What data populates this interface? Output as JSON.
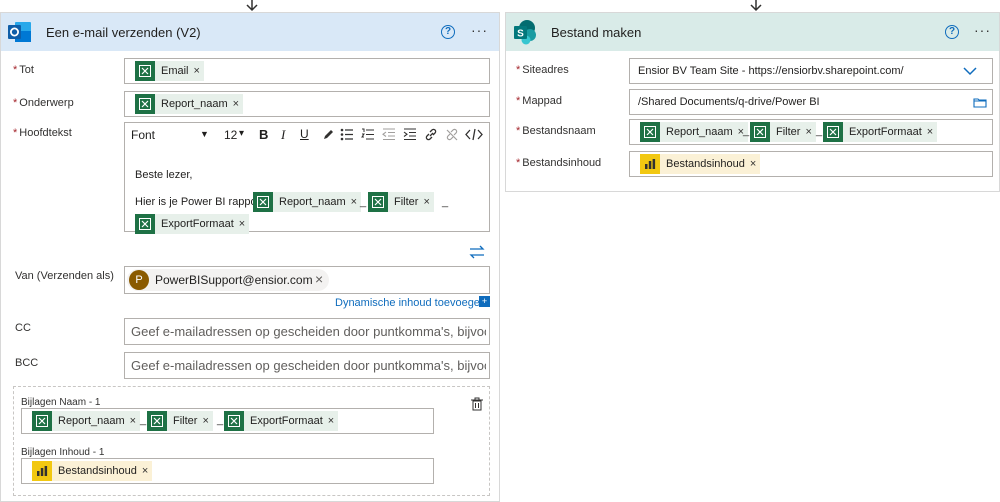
{
  "email_card": {
    "title": "Een e-mail verzenden (V2)",
    "help": "?",
    "more": "···",
    "to_label": "Tot",
    "to_tokens": [
      {
        "label": "Email",
        "close": "×"
      }
    ],
    "subject_label": "Onderwerp",
    "subject_tokens": [
      {
        "label": "Report_naam",
        "close": "×"
      }
    ],
    "body_label": "Hoofdtekst",
    "toolbar": {
      "font": "Font",
      "font_caret": "▼",
      "size": "12",
      "size_caret": "▾",
      "bold": "B",
      "italic": "I",
      "underline": "U"
    },
    "body_greeting": "Beste lezer,",
    "body_line": "Hier is je Power BI rapport",
    "body_tokens": [
      {
        "label": "Report_naam",
        "close": "×"
      },
      {
        "label": "Filter",
        "close": "×"
      },
      {
        "label": "ExportFormaat",
        "close": "×"
      }
    ],
    "separator": "_",
    "from_label": "Van (Verzenden als)",
    "from_avatar": "P",
    "from_value": "PowerBISupport@ensior.com",
    "from_close": "×",
    "dynamic_link": "Dynamische inhoud toevoegen",
    "cc_label": "CC",
    "cc_placeholder": "Geef e-mailadressen op gescheiden door puntkomma's, bijvoorbeeld",
    "bcc_label": "BCC",
    "bcc_placeholder": "Geef e-mailadressen op gescheiden door puntkomma's, bijvoorbeeld",
    "attach_name_label": "Bijlagen Naam - 1",
    "attach_name_tokens": [
      {
        "label": "Report_naam",
        "close": "×"
      },
      {
        "label": "Filter",
        "close": "×"
      },
      {
        "label": "ExportFormaat",
        "close": "×"
      }
    ],
    "attach_content_label": "Bijlagen Inhoud - 1",
    "attach_content_tokens": [
      {
        "label": "Bestandsinhoud",
        "close": "×"
      }
    ]
  },
  "file_card": {
    "title": "Bestand maken",
    "help": "?",
    "more": "···",
    "site_label": "Siteadres",
    "site_value": "Ensior BV Team Site - https://ensiorbv.sharepoint.com/",
    "folder_label": "Mappad",
    "folder_value": "/Shared Documents/q-drive/Power BI",
    "filename_label": "Bestandsnaam",
    "filename_tokens": [
      {
        "label": "Report_naam",
        "close": "×"
      },
      {
        "label": "Filter",
        "close": "×"
      },
      {
        "label": "ExportFormaat",
        "close": "×"
      }
    ],
    "content_label": "Bestandsinhoud",
    "content_tokens": [
      {
        "label": "Bestandsinhoud",
        "close": "×"
      }
    ]
  },
  "required_mark": "*",
  "colors": {
    "email_header": "#d9e8f7",
    "file_header": "#d9ebe8",
    "excel_green": "#1e7145",
    "token_bg": "#e7f0ea",
    "pbi_yellow": "#f2c811",
    "link_blue": "#0f6cbd"
  }
}
